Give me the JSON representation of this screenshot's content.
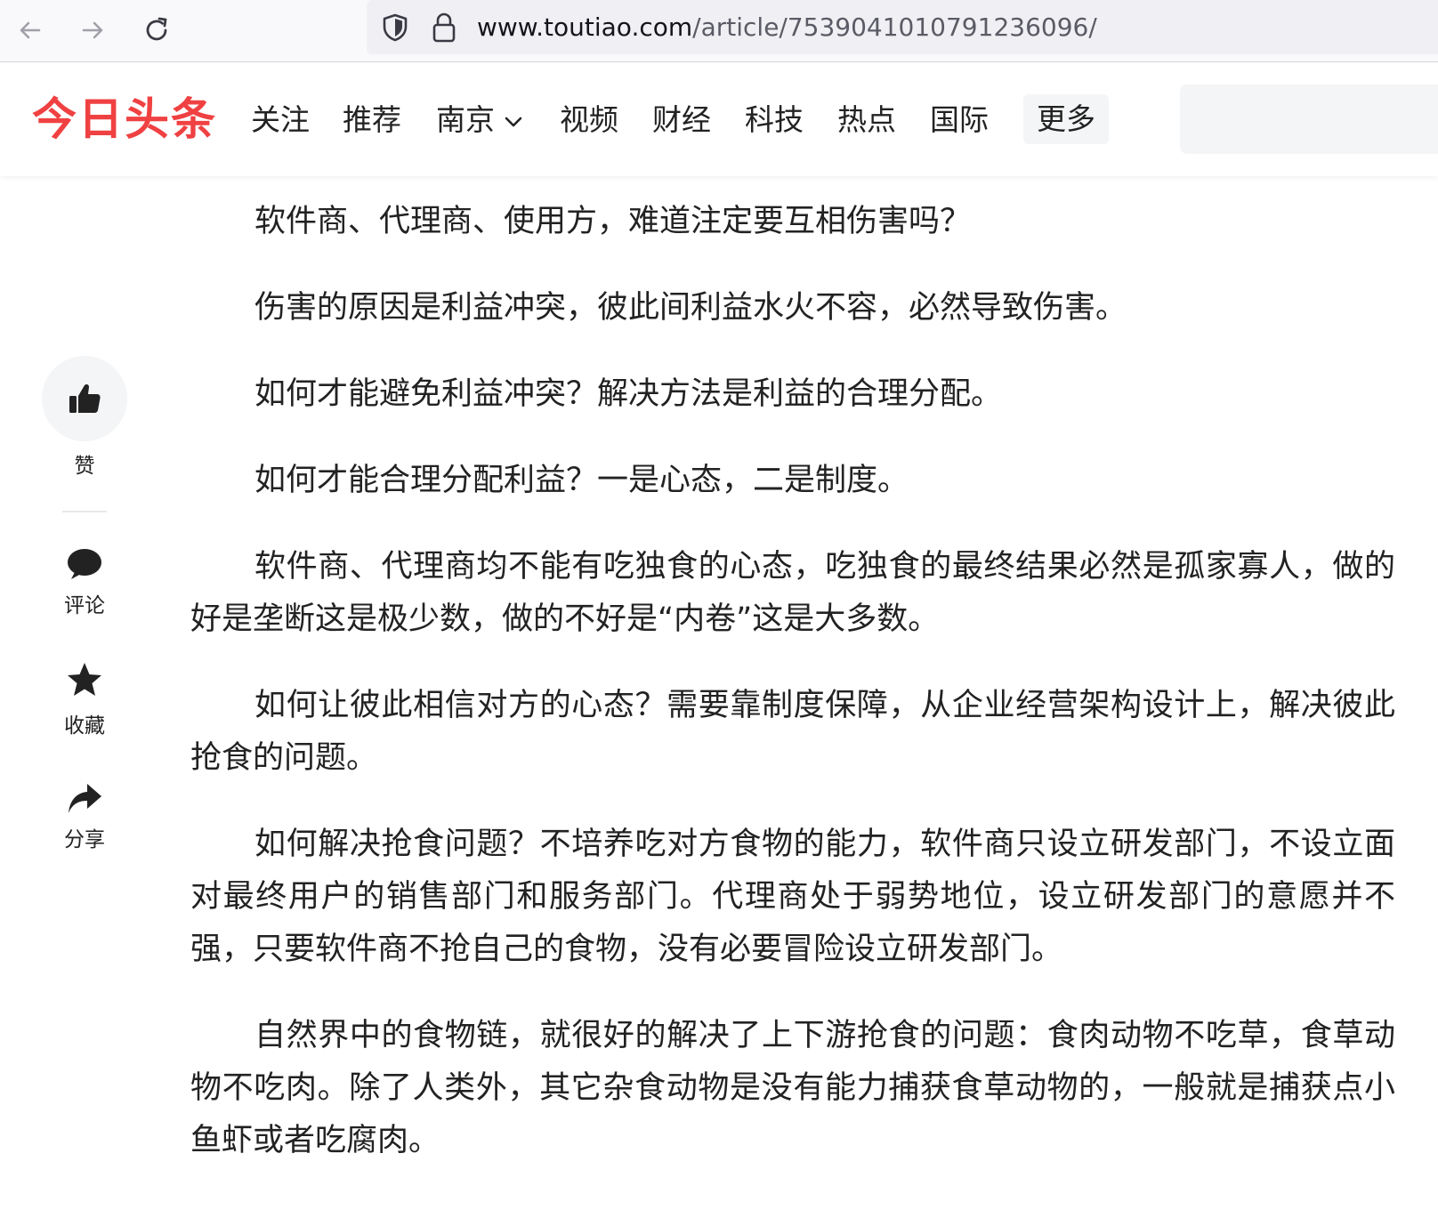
{
  "browser": {
    "url_domain": "www.toutiao.com",
    "url_path": "/article/7539041010791236096/"
  },
  "header": {
    "logo": "今日头条",
    "nav": [
      "关注",
      "推荐",
      "南京",
      "视频",
      "财经",
      "科技",
      "热点",
      "国际"
    ],
    "more": "更多"
  },
  "rail": {
    "like": "赞",
    "comment": "评论",
    "favorite": "收藏",
    "share": "分享"
  },
  "article": {
    "paragraphs": [
      "软件商、代理商、使用方，难道注定要互相伤害吗？",
      "伤害的原因是利益冲突，彼此间利益水火不容，必然导致伤害。",
      "如何才能避免利益冲突？解决方法是利益的合理分配。",
      "如何才能合理分配利益？一是心态，二是制度。",
      "软件商、代理商均不能有吃独食的心态，吃独食的最终结果必然是孤家寡人，做的好是垄断这是极少数，做的不好是“内卷”这是大多数。",
      "如何让彼此相信对方的心态？需要靠制度保障，从企业经营架构设计上，解决彼此抢食的问题。",
      "如何解决抢食问题？不培养吃对方食物的能力，软件商只设立研发部门，不设立面对最终用户的销售部门和服务部门。代理商处于弱势地位，设立研发部门的意愿并不强，只要软件商不抢自己的食物，没有必要冒险设立研发部门。",
      "自然界中的食物链，就很好的解决了上下游抢食的问题：食肉动物不吃草，食草动物不吃肉。除了人类外，其它杂食动物是没有能力捕获食草动物的，一般就是捕获点小鱼虾或者吃腐肉。"
    ]
  },
  "colors": {
    "brand": "#f04142",
    "text": "#222222",
    "surface": "#f4f5f6"
  }
}
